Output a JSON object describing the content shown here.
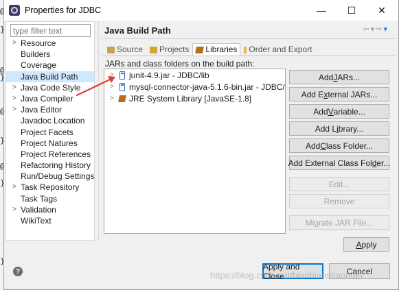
{
  "window": {
    "title": "Properties for JDBC",
    "minimize_glyph": "—",
    "maximize_glyph": "☐",
    "close_glyph": "✕"
  },
  "background_editor": {
    "glyphs": [
      "@",
      "}",
      "@",
      "}",
      "@",
      "}",
      "@",
      "}",
      "}"
    ]
  },
  "filter": {
    "placeholder": "type filter text",
    "value": "type filter text"
  },
  "tree": {
    "items": [
      {
        "label": "Resource",
        "expandable": true
      },
      {
        "label": "Builders",
        "expandable": false
      },
      {
        "label": "Coverage",
        "expandable": false
      },
      {
        "label": "Java Build Path",
        "expandable": false,
        "selected": true
      },
      {
        "label": "Java Code Style",
        "expandable": true
      },
      {
        "label": "Java Compiler",
        "expandable": true
      },
      {
        "label": "Java Editor",
        "expandable": true
      },
      {
        "label": "Javadoc Location",
        "expandable": false
      },
      {
        "label": "Project Facets",
        "expandable": false
      },
      {
        "label": "Project Natures",
        "expandable": false
      },
      {
        "label": "Project References",
        "expandable": false
      },
      {
        "label": "Refactoring History",
        "expandable": false
      },
      {
        "label": "Run/Debug Settings",
        "expandable": false
      },
      {
        "label": "Task Repository",
        "expandable": true
      },
      {
        "label": "Task Tags",
        "expandable": false
      },
      {
        "label": "Validation",
        "expandable": true
      },
      {
        "label": "WikiText",
        "expandable": false
      }
    ]
  },
  "page": {
    "title": "Java Build Path",
    "nav": {
      "back": "⇦",
      "back_menu": "▾",
      "forward": "⇨",
      "forward_menu": "▾"
    }
  },
  "tabs": [
    {
      "label": "Source",
      "icon": "source-folder-icon",
      "active": false
    },
    {
      "label": "Projects",
      "icon": "project-icon",
      "active": false
    },
    {
      "label": "Libraries",
      "icon": "library-icon",
      "active": true
    },
    {
      "label": "Order and Export",
      "icon": "order-export-icon",
      "active": false
    }
  ],
  "libraries": {
    "section_label": "JARs and class folders on the build path:",
    "items": [
      {
        "label": "junit-4.9.jar - JDBC/lib",
        "icon": "jar-icon"
      },
      {
        "label": "mysql-connector-java-5.1.6-bin.jar - JDBC/lib",
        "icon": "jar-icon"
      },
      {
        "label": "JRE System Library [JavaSE-1.8]",
        "icon": "jre-library-icon"
      }
    ]
  },
  "buttons": {
    "add_jars": {
      "pre": "Add ",
      "key": "J",
      "post": "ARs..."
    },
    "add_external_jars": {
      "pre": "Add E",
      "key": "x",
      "post": "ternal JARs..."
    },
    "add_variable": {
      "pre": "Add ",
      "key": "V",
      "post": "ariable..."
    },
    "add_library": {
      "pre": "Add L",
      "key": "i",
      "post": "brary..."
    },
    "add_class_folder": {
      "pre": "Add ",
      "key": "C",
      "post": "lass Folder..."
    },
    "add_external_class_folder": {
      "pre": "Add External Class Fol",
      "key": "d",
      "post": "er..."
    },
    "edit": "Edit...",
    "remove": "Remove",
    "migrate": "Migrate JAR File...",
    "apply": {
      "pre": "",
      "key": "A",
      "post": "pply"
    },
    "apply_and_close": "Apply and Close",
    "cancel": "Cancel"
  },
  "footer": {
    "help_glyph": "?",
    "watermark": "https://blog.csdn.net/bianbianshaonian"
  },
  "colors": {
    "selection": "#cde8ff",
    "annotation_arrow": "#e53935",
    "default_button_border": "#0078d7"
  }
}
